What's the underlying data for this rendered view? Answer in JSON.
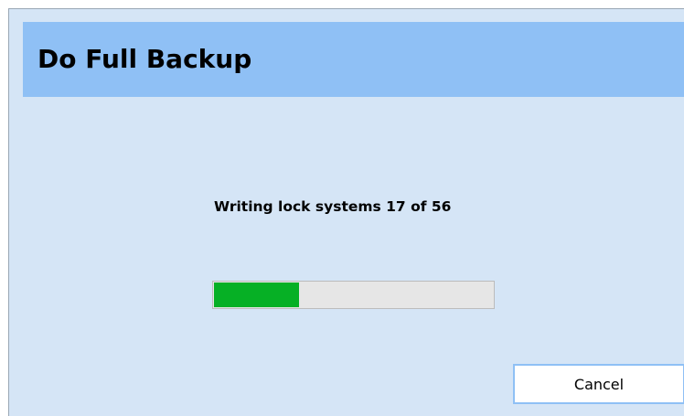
{
  "dialog": {
    "title": "Do Full Backup",
    "status_text": "Writing lock systems 17 of 56",
    "progress": {
      "current": 17,
      "total": 56,
      "fraction": 0.304
    },
    "cancel_label": "Cancel"
  },
  "colors": {
    "background": "#d5e5f6",
    "header": "#8fc0f5",
    "progress_fill": "#06b025",
    "progress_track": "#e6e6e6"
  }
}
